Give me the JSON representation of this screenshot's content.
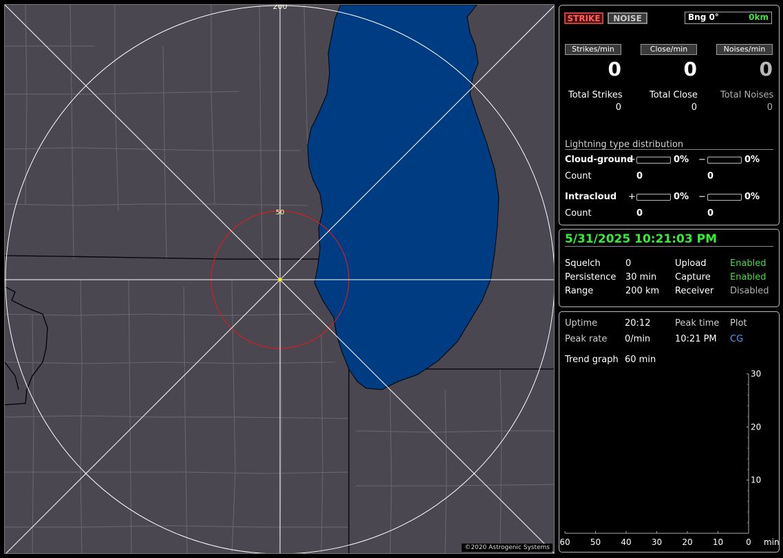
{
  "map": {
    "label_200": "200",
    "label_50": "50",
    "copyright": "©2020 Astrogenic Systems",
    "colors": {
      "land": "#4a4750",
      "water": "#003c82",
      "range_circle": "#d02020",
      "grid": "#ffffff",
      "center": "#ffff00"
    }
  },
  "header": {
    "strike_tab": "STRIKE",
    "noise_tab": "NOISE",
    "bearing": "Bng 0°",
    "distance": "0km"
  },
  "rates": {
    "strikes_btn": "Strikes/min",
    "close_btn": "Close/min",
    "noises_btn": "Noises/min",
    "strikes_value": "0",
    "close_value": "0",
    "noises_value": "0"
  },
  "totals": {
    "strikes_label": "Total Strikes",
    "close_label": "Total Close",
    "noises_label": "Total Noises",
    "strikes_value": "0",
    "close_value": "0",
    "noises_value": "0"
  },
  "distribution": {
    "title": "Lightning type distribution",
    "cg_label": "Cloud-ground",
    "ic_label": "Intracloud",
    "plus": "+",
    "minus": "−",
    "count_label": "Count",
    "cg_pos_pct": "0%",
    "cg_neg_pct": "0%",
    "ic_pos_pct": "0%",
    "ic_neg_pct": "0%",
    "cg_pos_count": "0",
    "cg_neg_count": "0",
    "ic_pos_count": "0",
    "ic_neg_count": "0"
  },
  "status": {
    "datetime": "5/31/2025 10:21:03 PM",
    "squelch_label": "Squelch",
    "squelch_value": "0",
    "persistence_label": "Persistence",
    "persistence_value": "30 min",
    "range_label": "Range",
    "range_value": "200 km",
    "upload_label": "Upload",
    "upload_value": "Enabled",
    "capture_label": "Capture",
    "capture_value": "Enabled",
    "receiver_label": "Receiver",
    "receiver_value": "Disabled"
  },
  "stats": {
    "uptime_label": "Uptime",
    "uptime_value": "20:12",
    "peak_time_label": "Peak time",
    "plot_label": "Plot",
    "peak_rate_label": "Peak rate",
    "peak_rate_value": "0/min",
    "peak_time_value": "10:21 PM",
    "plot_value": "CG",
    "trend_label": "Trend graph",
    "trend_value": "60 min"
  },
  "chart_data": {
    "type": "line",
    "title": "",
    "xlabel": "min",
    "ylabel": "",
    "x_ticks": [
      "60",
      "50",
      "40",
      "30",
      "20",
      "10",
      "0"
    ],
    "y_ticks": [
      "30",
      "20",
      "10"
    ],
    "xlim": [
      60,
      0
    ],
    "ylim": [
      0,
      30
    ],
    "series": []
  }
}
